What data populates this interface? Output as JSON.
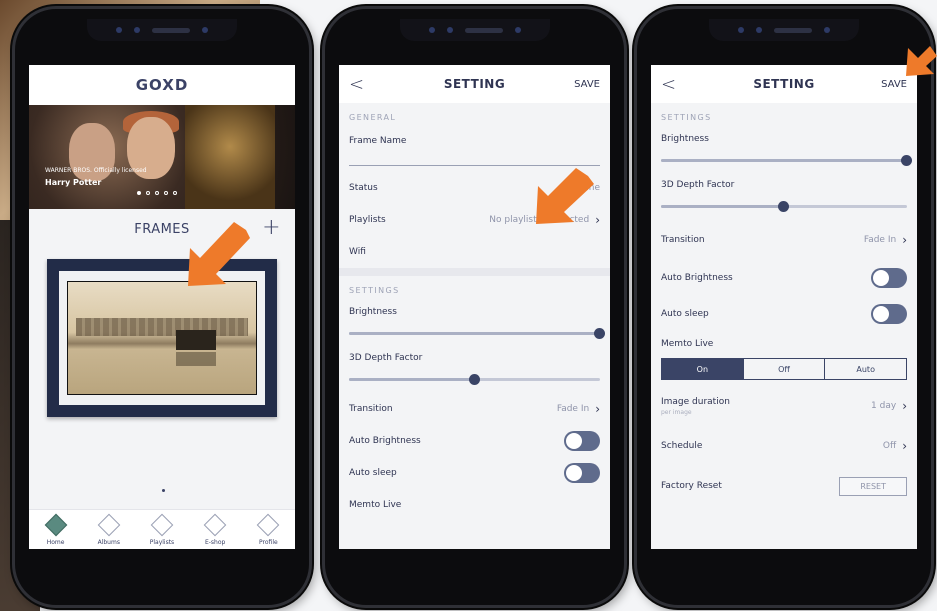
{
  "phone1": {
    "app_title": "GOXD",
    "hero": {
      "badge_text": "WARNER BROS. Officially licensed",
      "caption": "Harry Potter"
    },
    "frames_heading": "FRAMES",
    "add_symbol": "+",
    "tabs": [
      {
        "label": "Home",
        "active": true
      },
      {
        "label": "Albums",
        "active": false
      },
      {
        "label": "Playlists",
        "active": false
      },
      {
        "label": "E-shop",
        "active": false
      },
      {
        "label": "Profile",
        "active": false
      }
    ]
  },
  "phone2": {
    "nav": {
      "back": "<",
      "title": "SETTING",
      "save": "SAVE"
    },
    "general_header": "GENERAL",
    "frame_name_label": "Frame Name",
    "status_label": "Status",
    "status_value": "Offline",
    "playlists_label": "Playlists",
    "playlists_value": "No playlist(s) selected",
    "wifi_label": "Wifi",
    "settings_header": "SETTINGS",
    "brightness_label": "Brightness",
    "brightness_level": 1.0,
    "depth_label": "3D Depth Factor",
    "depth_level": 0.5,
    "transition_label": "Transition",
    "transition_value": "Fade In",
    "auto_brightness_label": "Auto Brightness",
    "auto_sleep_label": "Auto sleep",
    "partial_label": "Memto Live"
  },
  "phone3": {
    "nav": {
      "back": "<",
      "title": "SETTING",
      "save": "SAVE"
    },
    "settings_header": "SETTINGS",
    "brightness_label": "Brightness",
    "brightness_level": 1.0,
    "depth_label": "3D Depth Factor",
    "depth_level": 0.5,
    "transition_label": "Transition",
    "transition_value": "Fade In",
    "auto_brightness_label": "Auto Brightness",
    "auto_sleep_label": "Auto sleep",
    "memto_live_label": "Memto Live",
    "memto_options": [
      "On",
      "Off",
      "Auto"
    ],
    "memto_selected": "On",
    "image_duration_label": "Image duration",
    "image_duration_sub": "per image",
    "image_duration_value": "1 day",
    "schedule_label": "Schedule",
    "schedule_value": "Off",
    "factory_reset_label": "Factory Reset",
    "reset_button": "RESET"
  },
  "colors": {
    "accent_arrow": "#ee7a2a",
    "brand_navy": "#3a4466"
  },
  "icons": {
    "chevron": "chevron-right-icon",
    "back": "chevron-left-icon",
    "add": "plus-icon"
  }
}
